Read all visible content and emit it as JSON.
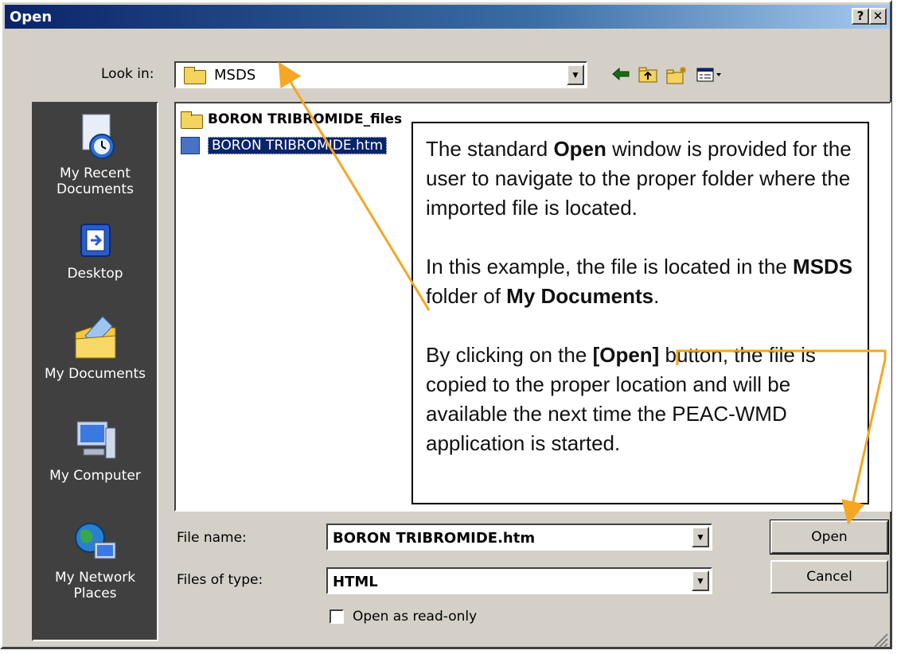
{
  "window": {
    "title": "Open"
  },
  "titlebar_buttons": {
    "help": "?",
    "close": "✕"
  },
  "look_in": {
    "label": "Look in:",
    "value": "MSDS"
  },
  "places": [
    {
      "label": "My Recent Documents",
      "icon": "recent-documents-icon"
    },
    {
      "label": "Desktop",
      "icon": "desktop-icon"
    },
    {
      "label": "My Documents",
      "icon": "my-documents-icon"
    },
    {
      "label": "My Computer",
      "icon": "my-computer-icon"
    },
    {
      "label": "My Network Places",
      "icon": "network-places-icon"
    }
  ],
  "files": [
    {
      "name": "BORON TRIBROMIDE_files",
      "type": "folder"
    },
    {
      "name": "BORON TRIBROMIDE.htm",
      "type": "htm",
      "selected": true
    }
  ],
  "callout": {
    "p1_a": "The standard ",
    "p1_b": "Open",
    "p1_c": " window is provided for the user to navigate to the proper folder where the imported file is located.",
    "p2_a": "In this example, the file is located in the ",
    "p2_b": "MSDS",
    "p2_c": " folder of ",
    "p2_d": "My Documents",
    "p2_e": ".",
    "p3_a": "By clicking on the ",
    "p3_b": "[Open]",
    "p3_c": " button, the file is copied to the proper location and will be available the next time the PEAC-WMD application is started."
  },
  "file_name": {
    "label": "File name:",
    "value": "BORON TRIBROMIDE.htm"
  },
  "file_type": {
    "label": "Files of type:",
    "value": "HTML"
  },
  "read_only": {
    "label": "Open as read-only",
    "checked": false
  },
  "buttons": {
    "open": "Open",
    "cancel": "Cancel"
  },
  "colors": {
    "arrow": "#f5a623",
    "title_start": "#0a246a",
    "title_end": "#a6caf0"
  }
}
